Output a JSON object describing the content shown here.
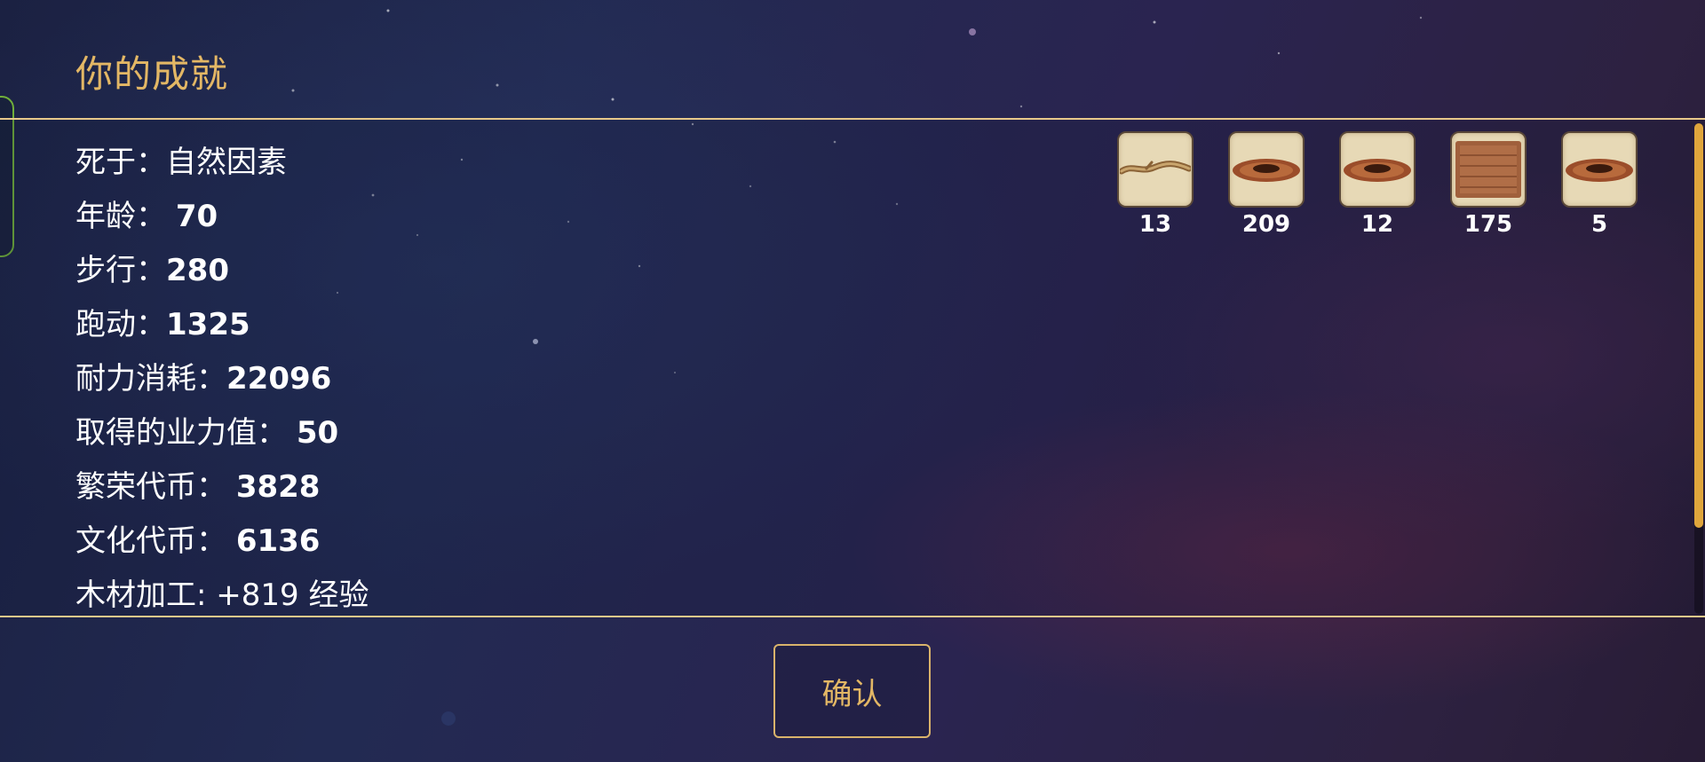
{
  "title": "你的成就",
  "stats": [
    {
      "label": "死于：",
      "value": "自然因素"
    },
    {
      "label": "年龄： ",
      "value": "70"
    },
    {
      "label": "步行：",
      "value": "280"
    },
    {
      "label": "跑动：",
      "value": "1325"
    },
    {
      "label": "耐力消耗：",
      "value": "22096"
    },
    {
      "label": "取得的业力值： ",
      "value": "50"
    },
    {
      "label": "繁荣代币： ",
      "value": "3828"
    },
    {
      "label": "文化代币： ",
      "value": "6136"
    },
    {
      "label": "木材加工: ",
      "value": "+819 经验"
    }
  ],
  "rewards": [
    {
      "icon": "wood-stick-icon",
      "count": "13"
    },
    {
      "icon": "nest-icon",
      "count": "209"
    },
    {
      "icon": "nest-icon",
      "count": "12"
    },
    {
      "icon": "fiber-mat-icon",
      "count": "175"
    },
    {
      "icon": "nest-icon",
      "count": "5"
    }
  ],
  "confirm_label": "确认",
  "colors": {
    "title": "#e3b765",
    "border": "#e8c98a",
    "slot_bg": "#e7d9b6",
    "scroll_thumb": "#e0a63c",
    "side_tab": "#6fae3a"
  },
  "scroll_position": 0
}
